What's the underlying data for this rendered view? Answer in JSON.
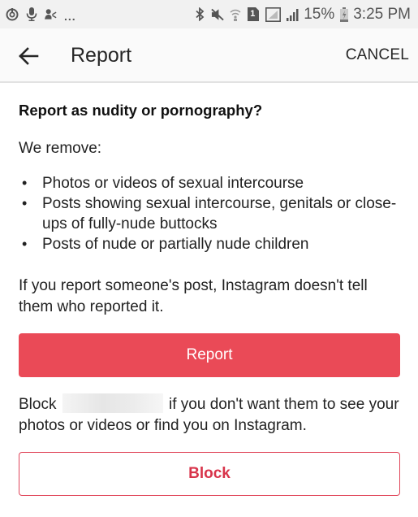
{
  "status_bar": {
    "left_icons": [
      "sync-icon",
      "microphone-icon",
      "person-share-icon"
    ],
    "overflow": "...",
    "right_icons": [
      "bluetooth-icon",
      "mute-icon",
      "wifi-icon",
      "sim-icon",
      "signal-box-icon",
      "signal-icon"
    ],
    "sim_label": "1",
    "battery_percent": "15%",
    "time": "3:25 PM"
  },
  "app_bar": {
    "back_icon": "arrow-left-icon",
    "title": "Report",
    "cancel_label": "CANCEL"
  },
  "content": {
    "question": "Report as nudity or pornography?",
    "we_remove": "We remove:",
    "bullets": [
      "Photos or videos of sexual intercourse",
      "Posts showing sexual intercourse, genitals or close-ups of fully-nude buttocks",
      "Posts of nude or partially nude children"
    ],
    "notice": "If you report someone's post, Instagram doesn't tell them who reported it.",
    "report_button": "Report",
    "block_prefix": "Block",
    "block_suffix": "if you don't want them to see your photos or videos or find you on Instagram.",
    "block_button": "Block"
  },
  "colors": {
    "report_button_bg": "#ea4a57",
    "block_button_text": "#d8344b"
  }
}
